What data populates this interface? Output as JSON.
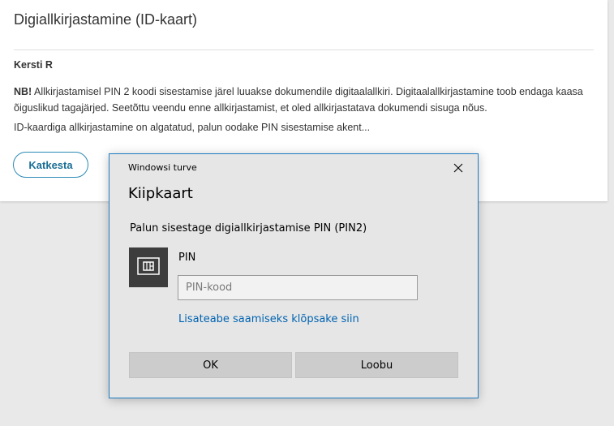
{
  "web": {
    "title": "Digiallkirjastamine (ID-kaart)",
    "signer_name": "Kersti R",
    "warning_bold": "NB!",
    "warning_text": " Allkirjastamisel PIN 2 koodi sisestamise järel luuakse dokumendile digitaalallkiri. Digitaalallkirjastamine toob endaga kaasa õiguslikud tagajärjed. Seetõttu veendu enne allkirjastamist, et oled allkirjastatava dokumendi sisuga nõus.",
    "status_text": "ID-kaardiga allkirjastamine on algatatud, palun oodake PIN sisestamise akent...",
    "cancel_label": "Katkesta"
  },
  "dialog": {
    "caption": "Windowsi turve",
    "close_icon": "close-icon",
    "heading": "Kiipkaart",
    "prompt": "Palun sisestage digiallkirjastamise PIN (PIN2)",
    "card_icon": "smartcard-icon",
    "pin_label": "PIN",
    "pin_placeholder": "PIN-kood",
    "pin_value": "",
    "more_info_link": "Lisateabe saamiseks klõpsake siin",
    "ok_label": "OK",
    "cancel_label": "Loobu"
  },
  "colors": {
    "accent_blue": "#1f7bc1",
    "link_blue": "#0063b1",
    "button_outline": "#2c8ab4",
    "dialog_bg": "#e6e6e6",
    "tile_bg": "#3d3d3d"
  }
}
